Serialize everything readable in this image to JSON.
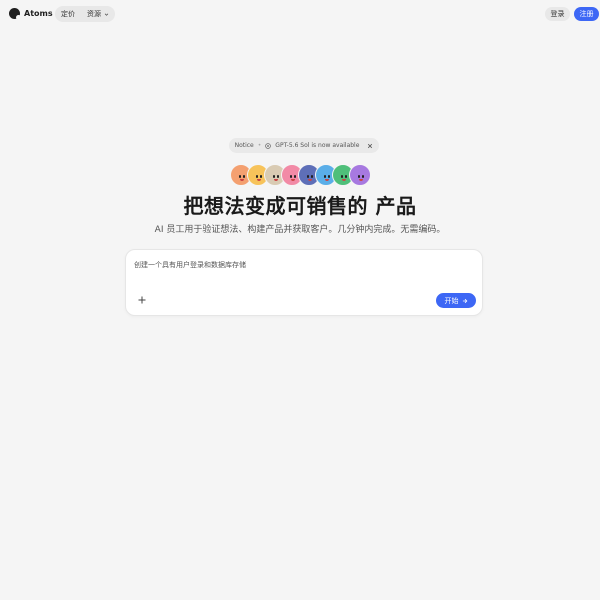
{
  "header": {
    "brand": "Atoms",
    "nav": [
      {
        "label": "定价"
      },
      {
        "label": "资源"
      }
    ],
    "login_label": "登录",
    "signup_label": "注册"
  },
  "notice": {
    "label": "Notice",
    "separator": "•",
    "message": "GPT-5.6 Sol is now available"
  },
  "avatars": [
    {
      "color": "#f4a070"
    },
    {
      "color": "#f7c35a"
    },
    {
      "color": "#d9cbb3"
    },
    {
      "color": "#f28aa6"
    },
    {
      "color": "#5e6fb8"
    },
    {
      "color": "#5aaee8"
    },
    {
      "color": "#4fbf7a"
    },
    {
      "color": "#a779e0"
    }
  ],
  "hero": {
    "title": "把想法变成可销售的 产品",
    "subtitle": "AI 员工用于验证想法、构建产品并获取客户。几分钟内完成。无需编码。"
  },
  "prompt": {
    "placeholder": "创建一个具有用户登录和数据库存储",
    "start_label": "开始"
  },
  "colors": {
    "accent": "#3d67f5",
    "background": "#f5f5f5"
  }
}
